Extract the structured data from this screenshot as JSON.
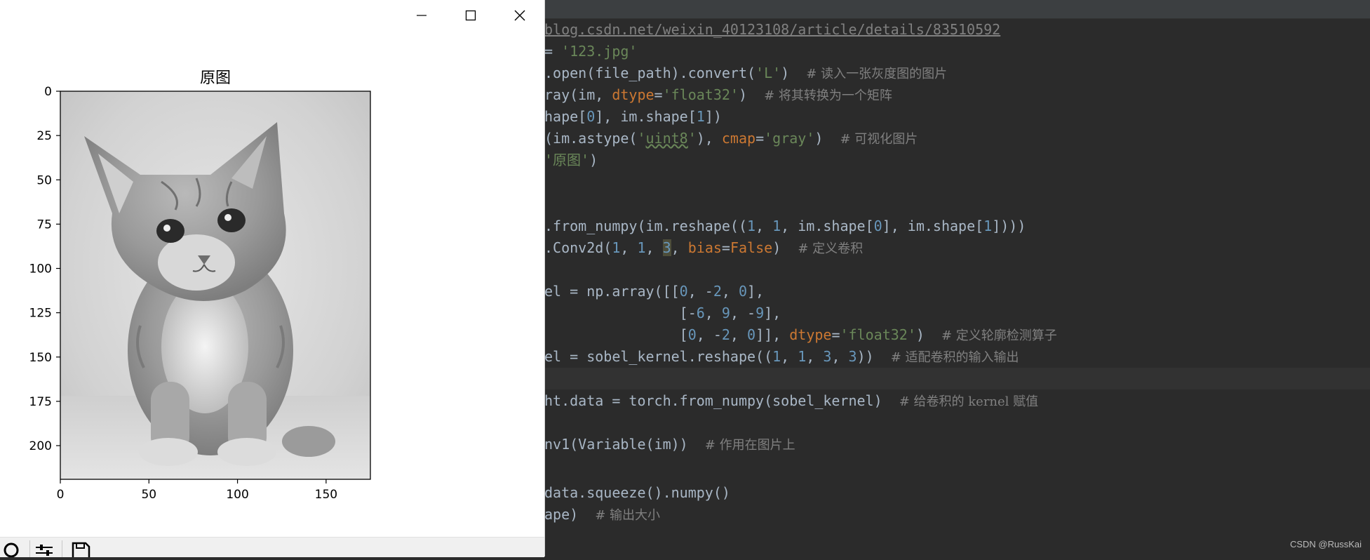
{
  "editor": {
    "lines": [
      {
        "top": 27,
        "segs": [
          [
            "t-url",
            "blog.csdn.net/weixin_40123108/article/details/83510592"
          ]
        ]
      },
      {
        "top": 58,
        "segs": [
          [
            "",
            "= "
          ],
          [
            "t-str",
            "'123.jpg'"
          ]
        ]
      },
      {
        "top": 89,
        "segs": [
          [
            "",
            ".open(file_path).convert("
          ],
          [
            "t-str",
            "'L'"
          ],
          [
            "",
            ")  "
          ],
          [
            "t-com",
            "# 读入一张灰度图的图片"
          ]
        ]
      },
      {
        "top": 120,
        "segs": [
          [
            "",
            "ray(im, "
          ],
          [
            "t-kw",
            "dtype"
          ],
          [
            "",
            "="
          ],
          [
            "t-str",
            "'float32'"
          ],
          [
            "",
            ")  "
          ],
          [
            "t-com",
            "# 将其转换为一个矩阵"
          ]
        ]
      },
      {
        "top": 151,
        "segs": [
          [
            "",
            "hape["
          ],
          [
            "t-num",
            "0"
          ],
          [
            "",
            "], im.shape["
          ],
          [
            "t-num",
            "1"
          ],
          [
            "",
            "])"
          ]
        ]
      },
      {
        "top": 182,
        "segs": [
          [
            "",
            "(im.astype("
          ],
          [
            "t-str",
            "'"
          ],
          [
            "t-str t-wavy",
            "uint8"
          ],
          [
            "t-str",
            "'"
          ],
          [
            "",
            "), "
          ],
          [
            "t-kw",
            "cmap"
          ],
          [
            "",
            "="
          ],
          [
            "t-str",
            "'gray'"
          ],
          [
            "",
            ")  "
          ],
          [
            "t-com",
            "# 可视化图片"
          ]
        ]
      },
      {
        "top": 213,
        "segs": [
          [
            "t-str",
            "'原图'"
          ],
          [
            "",
            ")"
          ]
        ]
      },
      {
        "top": 307,
        "segs": [
          [
            "",
            ".from_numpy(im.reshape(("
          ],
          [
            "t-num",
            "1"
          ],
          [
            "",
            ", "
          ],
          [
            "t-num",
            "1"
          ],
          [
            "",
            ", im.shape["
          ],
          [
            "t-num",
            "0"
          ],
          [
            "",
            "], im.shape["
          ],
          [
            "t-num",
            "1"
          ],
          [
            "",
            "])))"
          ]
        ]
      },
      {
        "top": 338,
        "segs": [
          [
            "",
            ".Conv2d("
          ],
          [
            "t-num",
            "1"
          ],
          [
            "",
            ", "
          ],
          [
            "t-num",
            "1"
          ],
          [
            "",
            ", "
          ],
          [
            "t-num t-sel",
            "3"
          ],
          [
            "",
            ", "
          ],
          [
            "t-kw",
            "bias"
          ],
          [
            "",
            "="
          ],
          [
            "t-kw",
            "False"
          ],
          [
            "",
            ")  "
          ],
          [
            "t-com",
            "# 定义卷积"
          ]
        ]
      },
      {
        "top": 400,
        "segs": [
          [
            "",
            "el = np.array([["
          ],
          [
            "t-num",
            "0"
          ],
          [
            "",
            ", -"
          ],
          [
            "t-num",
            "2"
          ],
          [
            "",
            ", "
          ],
          [
            "t-num",
            "0"
          ],
          [
            "",
            "],"
          ]
        ]
      },
      {
        "top": 431,
        "segs": [
          [
            "",
            "                ["
          ],
          [
            "",
            "-"
          ],
          [
            "t-num",
            "6"
          ],
          [
            "",
            ", "
          ],
          [
            "t-num",
            "9"
          ],
          [
            "",
            ", -"
          ],
          [
            "t-num",
            "9"
          ],
          [
            "",
            "],"
          ]
        ]
      },
      {
        "top": 462,
        "segs": [
          [
            "",
            "                ["
          ],
          [
            "t-num",
            "0"
          ],
          [
            "",
            ", -"
          ],
          [
            "t-num",
            "2"
          ],
          [
            "",
            ", "
          ],
          [
            "t-num",
            "0"
          ],
          [
            "",
            "]], "
          ],
          [
            "t-kw",
            "dtype"
          ],
          [
            "",
            "="
          ],
          [
            "t-str",
            "'float32'"
          ],
          [
            "",
            ")  "
          ],
          [
            "t-com",
            "# 定义轮廓检测算子"
          ]
        ]
      },
      {
        "top": 493,
        "segs": [
          [
            "",
            "el = sobel_kernel.reshape(("
          ],
          [
            "t-num",
            "1"
          ],
          [
            "",
            ", "
          ],
          [
            "t-num",
            "1"
          ],
          [
            "",
            ", "
          ],
          [
            "t-num",
            "3"
          ],
          [
            "",
            ", "
          ],
          [
            "t-num",
            "3"
          ],
          [
            "",
            "))  "
          ],
          [
            "t-com",
            "# 适配卷积的输入输出"
          ]
        ]
      },
      {
        "top": 524,
        "current": true,
        "segs": [
          [
            "",
            ""
          ]
        ]
      },
      {
        "top": 556,
        "segs": [
          [
            "",
            "ht.data = torch.from_numpy(sobel_kernel)  "
          ],
          [
            "t-com",
            "# 给卷积的 kernel 赋值"
          ]
        ]
      },
      {
        "top": 618,
        "segs": [
          [
            "",
            "nv1(Variable(im))  "
          ],
          [
            "t-com",
            "# 作用在图片上"
          ]
        ]
      },
      {
        "top": 687,
        "segs": [
          [
            "",
            "data.squeeze().numpy()"
          ]
        ]
      },
      {
        "top": 718,
        "segs": [
          [
            "",
            "ape)  "
          ],
          [
            "t-com",
            "# 输出大小"
          ]
        ]
      }
    ],
    "watermark": "CSDN @RussKai"
  },
  "figure_window": {
    "controls": {
      "minimize": "minimize-icon",
      "maximize": "maximize-icon",
      "close": "close-icon"
    },
    "toolbar_icons": [
      "zoom-icon",
      "configure-subplots-icon",
      "save-icon"
    ],
    "image_alt": "gray kitten photo"
  },
  "chart_data": {
    "type": "image",
    "title": "原图",
    "xlabel": "",
    "ylabel": "",
    "xlim": [
      0,
      175
    ],
    "ylim": [
      219,
      0
    ],
    "x_ticks": [
      "0",
      "50",
      "100",
      "150"
    ],
    "y_ticks": [
      "0",
      "25",
      "50",
      "75",
      "100",
      "125",
      "150",
      "175",
      "200"
    ],
    "cmap": "gray",
    "grid": false
  }
}
